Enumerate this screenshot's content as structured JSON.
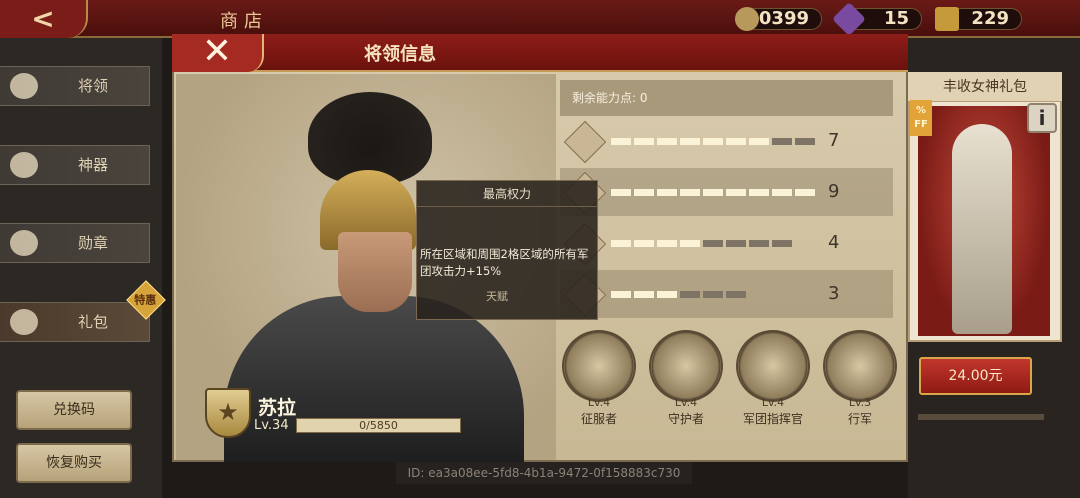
{
  "top_bar": {
    "title": "商店",
    "back_glyph": "<",
    "resources": [
      {
        "icon": "coin-icon",
        "value": "90399"
      },
      {
        "icon": "crystal-icon",
        "value": "15"
      },
      {
        "icon": "spqr-token-icon",
        "value": "229"
      }
    ]
  },
  "sidebar": {
    "items": [
      {
        "label": "将领",
        "icon": "helmet-icon"
      },
      {
        "label": "神器",
        "icon": "eye-icon"
      },
      {
        "label": "勋章",
        "icon": "eagle-icon"
      },
      {
        "label": "礼包",
        "icon": "chest-icon",
        "badge": "特惠"
      }
    ],
    "redeem_label": "兑换码",
    "restore_label": "恢复购买"
  },
  "gift_panel": {
    "title": "丰收女神礼包",
    "off_tag": "%\nFF",
    "price": "24.00元"
  },
  "modal": {
    "title": "将领信息",
    "remaining_points": "剩余能力点: 0",
    "hero": {
      "name": "苏拉",
      "level": "Lv.34",
      "xp": "0/5850"
    },
    "stats": [
      {
        "icon": "sword-icon",
        "value": "7",
        "filled": 7,
        "total": 9
      },
      {
        "icon": "shield-icon",
        "value": "9",
        "filled": 9,
        "total": 9
      },
      {
        "icon": "horse-icon",
        "value": "4",
        "filled": 4,
        "total": 8
      },
      {
        "icon": "anchor-icon",
        "value": "3",
        "filled": 3,
        "total": 6
      }
    ],
    "tooltip": {
      "title": "最高权力",
      "body": "所在区域和周围2格区域的所有军团攻击力+15%",
      "sub": "天赋"
    },
    "skills": [
      {
        "level": "Lv.4",
        "name": "征服者"
      },
      {
        "level": "Lv.4",
        "name": "守护者"
      },
      {
        "level": "Lv.4",
        "name": "军团指挥官"
      },
      {
        "level": "Lv.3",
        "name": "行军"
      }
    ]
  },
  "footer": {
    "id_text": "ID: ea3a08ee-5fd8-4b1a-9472-0f158883c730"
  },
  "colors": {
    "crimson": "#8e1d18",
    "gold": "#d9a64c",
    "parchment": "#d9ccae"
  }
}
